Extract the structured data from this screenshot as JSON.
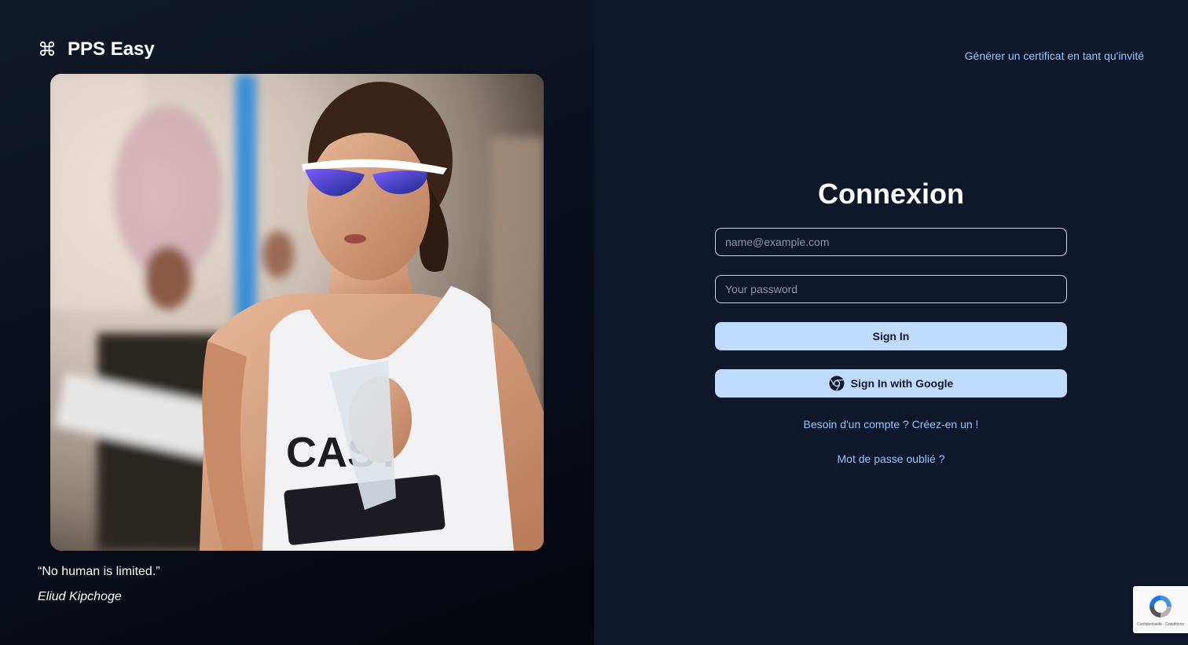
{
  "brand": {
    "icon": "command-icon",
    "symbol": "⌘",
    "name": "PPS Easy"
  },
  "hero": {
    "image": "runner-photo",
    "quote": "“No human is limited.”",
    "author": "Eliud Kipchoge"
  },
  "header": {
    "guest_link": "Générer un certificat en tant qu'invité"
  },
  "login": {
    "title": "Connexion",
    "email": {
      "placeholder": "name@example.com",
      "value": ""
    },
    "password": {
      "placeholder": "Your password",
      "value": ""
    },
    "sign_in_label": "Sign In",
    "google_label": "Sign In with Google",
    "google_icon": "chrome-icon",
    "signup_link": "Besoin d'un compte ? Créez-en un !",
    "forgot_link": "Mot de passe oublié ?"
  },
  "recaptcha": {
    "icon": "recaptcha-icon",
    "text": "Confidentialité - Conditions"
  },
  "colors": {
    "background": "#0f172a",
    "accent_link": "#93c5fd",
    "button": "#bfdbfe",
    "button_text": "#0f172a"
  }
}
